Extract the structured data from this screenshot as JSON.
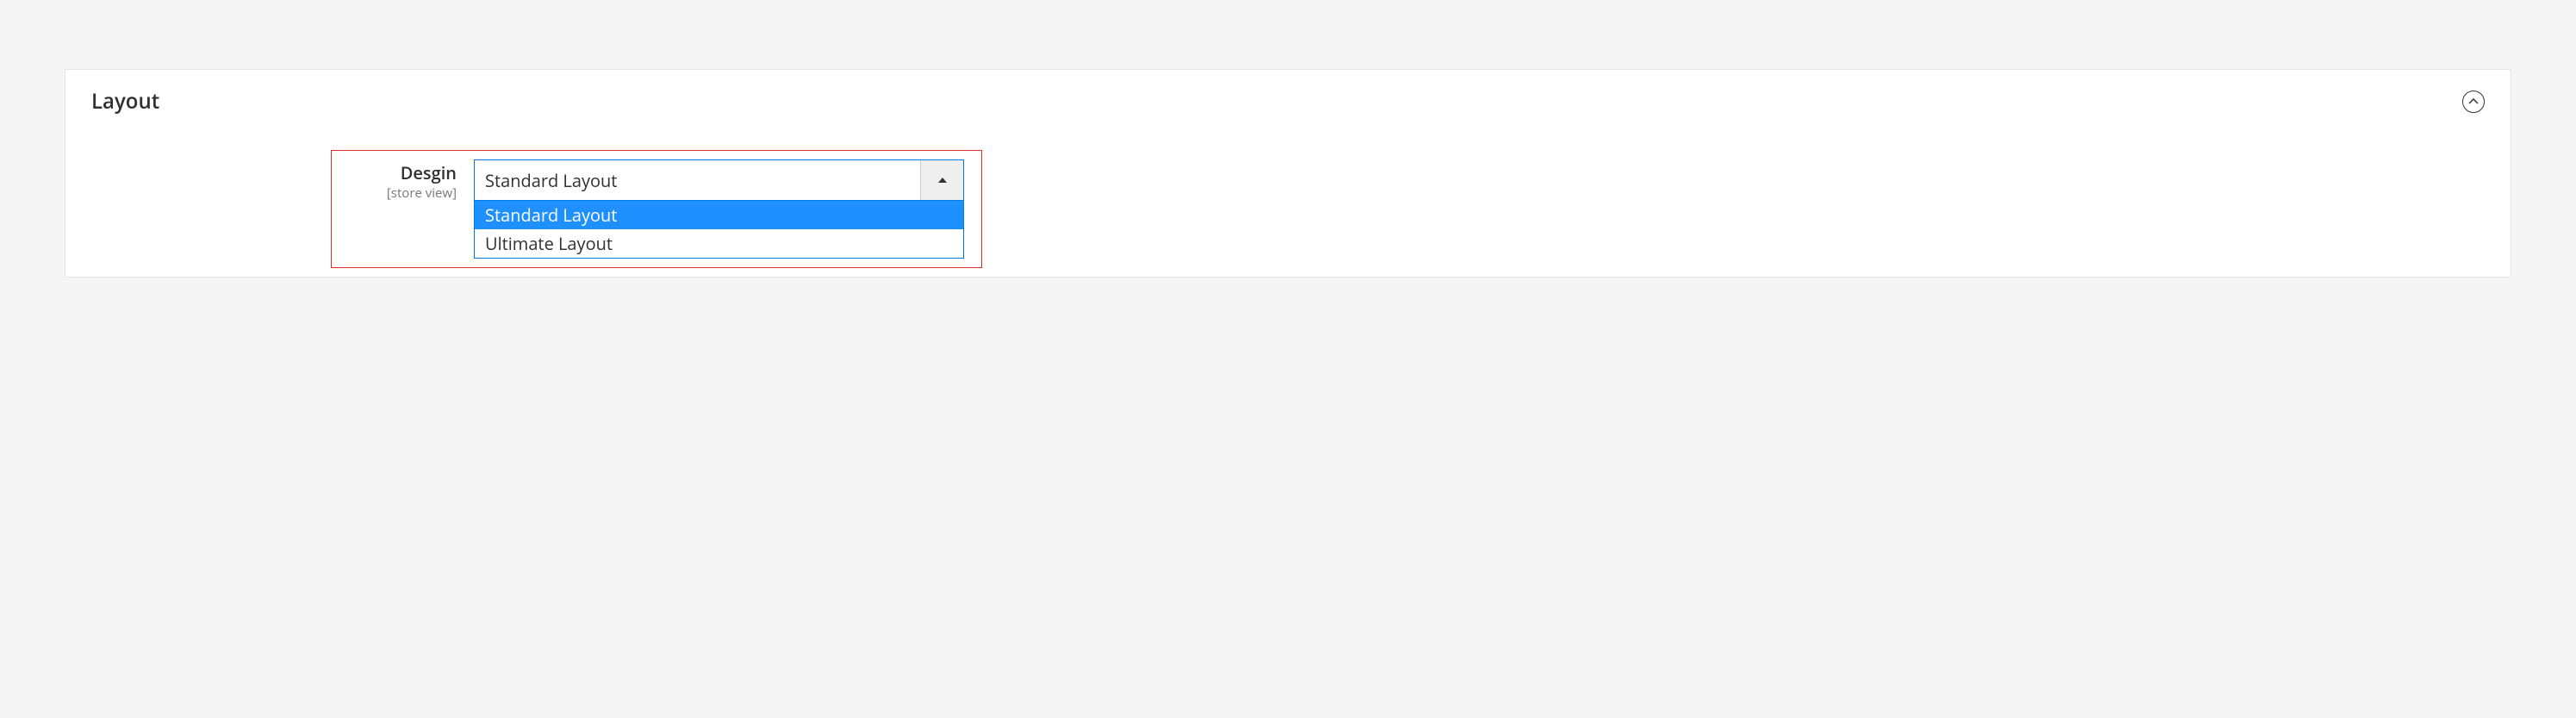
{
  "panel": {
    "title": "Layout"
  },
  "field": {
    "label": "Desgin",
    "scope": "[store view]",
    "selected": "Standard Layout",
    "options": [
      "Standard Layout",
      "Ultimate Layout"
    ]
  }
}
